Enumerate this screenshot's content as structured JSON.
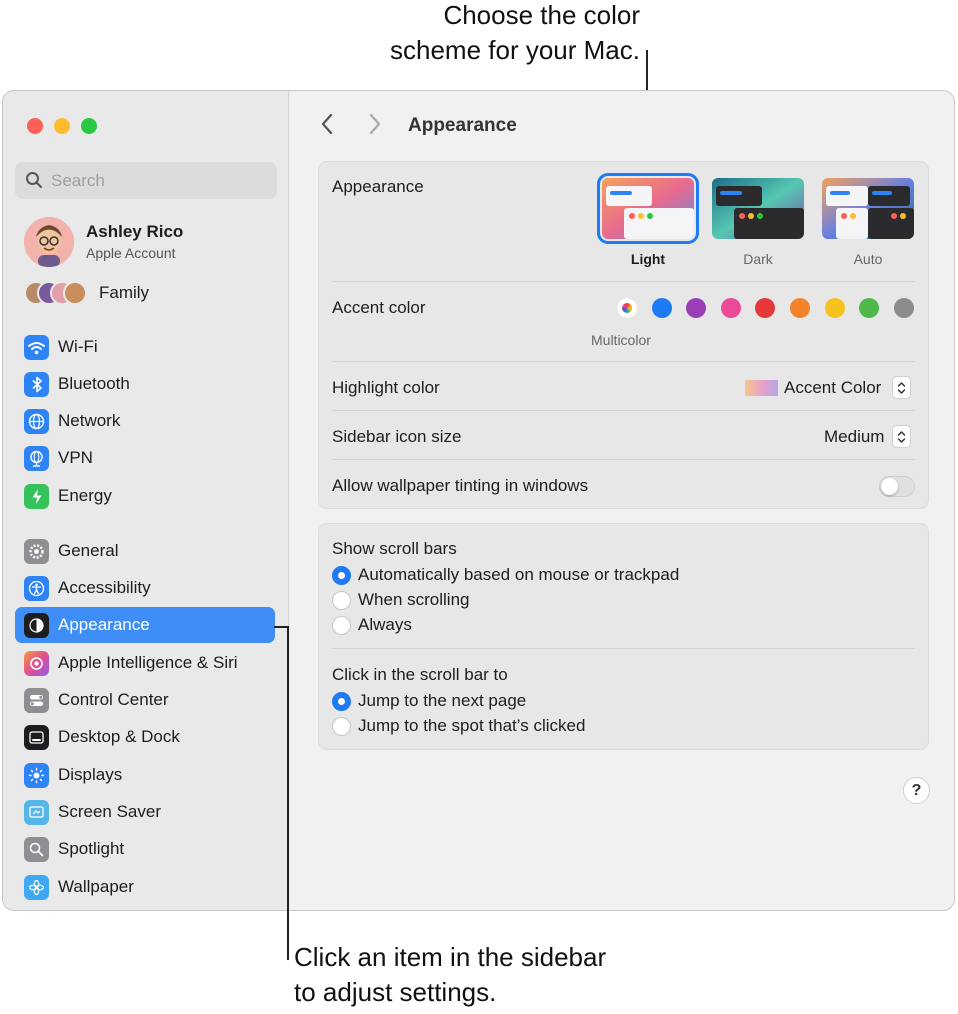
{
  "callouts": {
    "top_line1": "Choose the color",
    "top_line2": "scheme for your Mac.",
    "bottom_line1": "Click an item in the sidebar",
    "bottom_line2": "to adjust settings."
  },
  "search": {
    "placeholder": "Search",
    "icon": "magnifying-glass-icon"
  },
  "account": {
    "name": "Ashley Rico",
    "subtitle": "Apple Account"
  },
  "family": {
    "label": "Family"
  },
  "sidebar": {
    "selected": "Appearance",
    "items": [
      {
        "label": "Wi-Fi",
        "icon": "wifi-icon",
        "color": "#2f84f5"
      },
      {
        "label": "Bluetooth",
        "icon": "bluetooth-icon",
        "color": "#2f84f5"
      },
      {
        "label": "Network",
        "icon": "globe-icon",
        "color": "#2f84f5"
      },
      {
        "label": "VPN",
        "icon": "vpn-globe-icon",
        "color": "#2f84f5"
      },
      {
        "label": "Energy",
        "icon": "bolt-icon",
        "color": "#35c25a"
      },
      {
        "label": "General",
        "icon": "gear-icon",
        "color": "#8e8e93"
      },
      {
        "label": "Accessibility",
        "icon": "accessibility-icon",
        "color": "#2f84f5"
      },
      {
        "label": "Appearance",
        "icon": "appearance-icon",
        "color": "#1d1d1f"
      },
      {
        "label": "Apple Intelligence & Siri",
        "icon": "siri-icon",
        "color": "#c86ae0"
      },
      {
        "label": "Control Center",
        "icon": "control-center-icon",
        "color": "#8e8e93"
      },
      {
        "label": "Desktop & Dock",
        "icon": "dock-icon",
        "color": "#1d1d1f"
      },
      {
        "label": "Displays",
        "icon": "sun-icon",
        "color": "#2f84f5"
      },
      {
        "label": "Screen Saver",
        "icon": "screen-saver-icon",
        "color": "#56b6e8"
      },
      {
        "label": "Spotlight",
        "icon": "spotlight-icon",
        "color": "#8e8e93"
      },
      {
        "label": "Wallpaper",
        "icon": "wallpaper-icon",
        "color": "#3ea8f0"
      }
    ]
  },
  "header": {
    "title": "Appearance",
    "back_icon": "chevron-left-icon",
    "forward_icon": "chevron-right-icon"
  },
  "appearance": {
    "label": "Appearance",
    "options": [
      "Light",
      "Dark",
      "Auto"
    ],
    "selected": "Light"
  },
  "accent": {
    "label": "Accent color",
    "selected_label": "Multicolor",
    "colors": [
      "#1f7bf5",
      "#9a3fb5",
      "#e94b9a",
      "#e5383b",
      "#f38326",
      "#f7c21e",
      "#4fb84a",
      "#8c8c8c"
    ]
  },
  "highlight": {
    "label": "Highlight color",
    "value": "Accent Color"
  },
  "sidebar_icon_size": {
    "label": "Sidebar icon size",
    "value": "Medium"
  },
  "wallpaper_tinting": {
    "label": "Allow wallpaper tinting in windows",
    "enabled": false
  },
  "scroll_bars": {
    "label": "Show scroll bars",
    "options": [
      "Automatically based on mouse or trackpad",
      "When scrolling",
      "Always"
    ],
    "selected": 0
  },
  "scroll_click": {
    "label": "Click in the scroll bar to",
    "options": [
      "Jump to the next page",
      "Jump to the spot that’s clicked"
    ],
    "selected": 0
  },
  "help": {
    "label": "?"
  }
}
